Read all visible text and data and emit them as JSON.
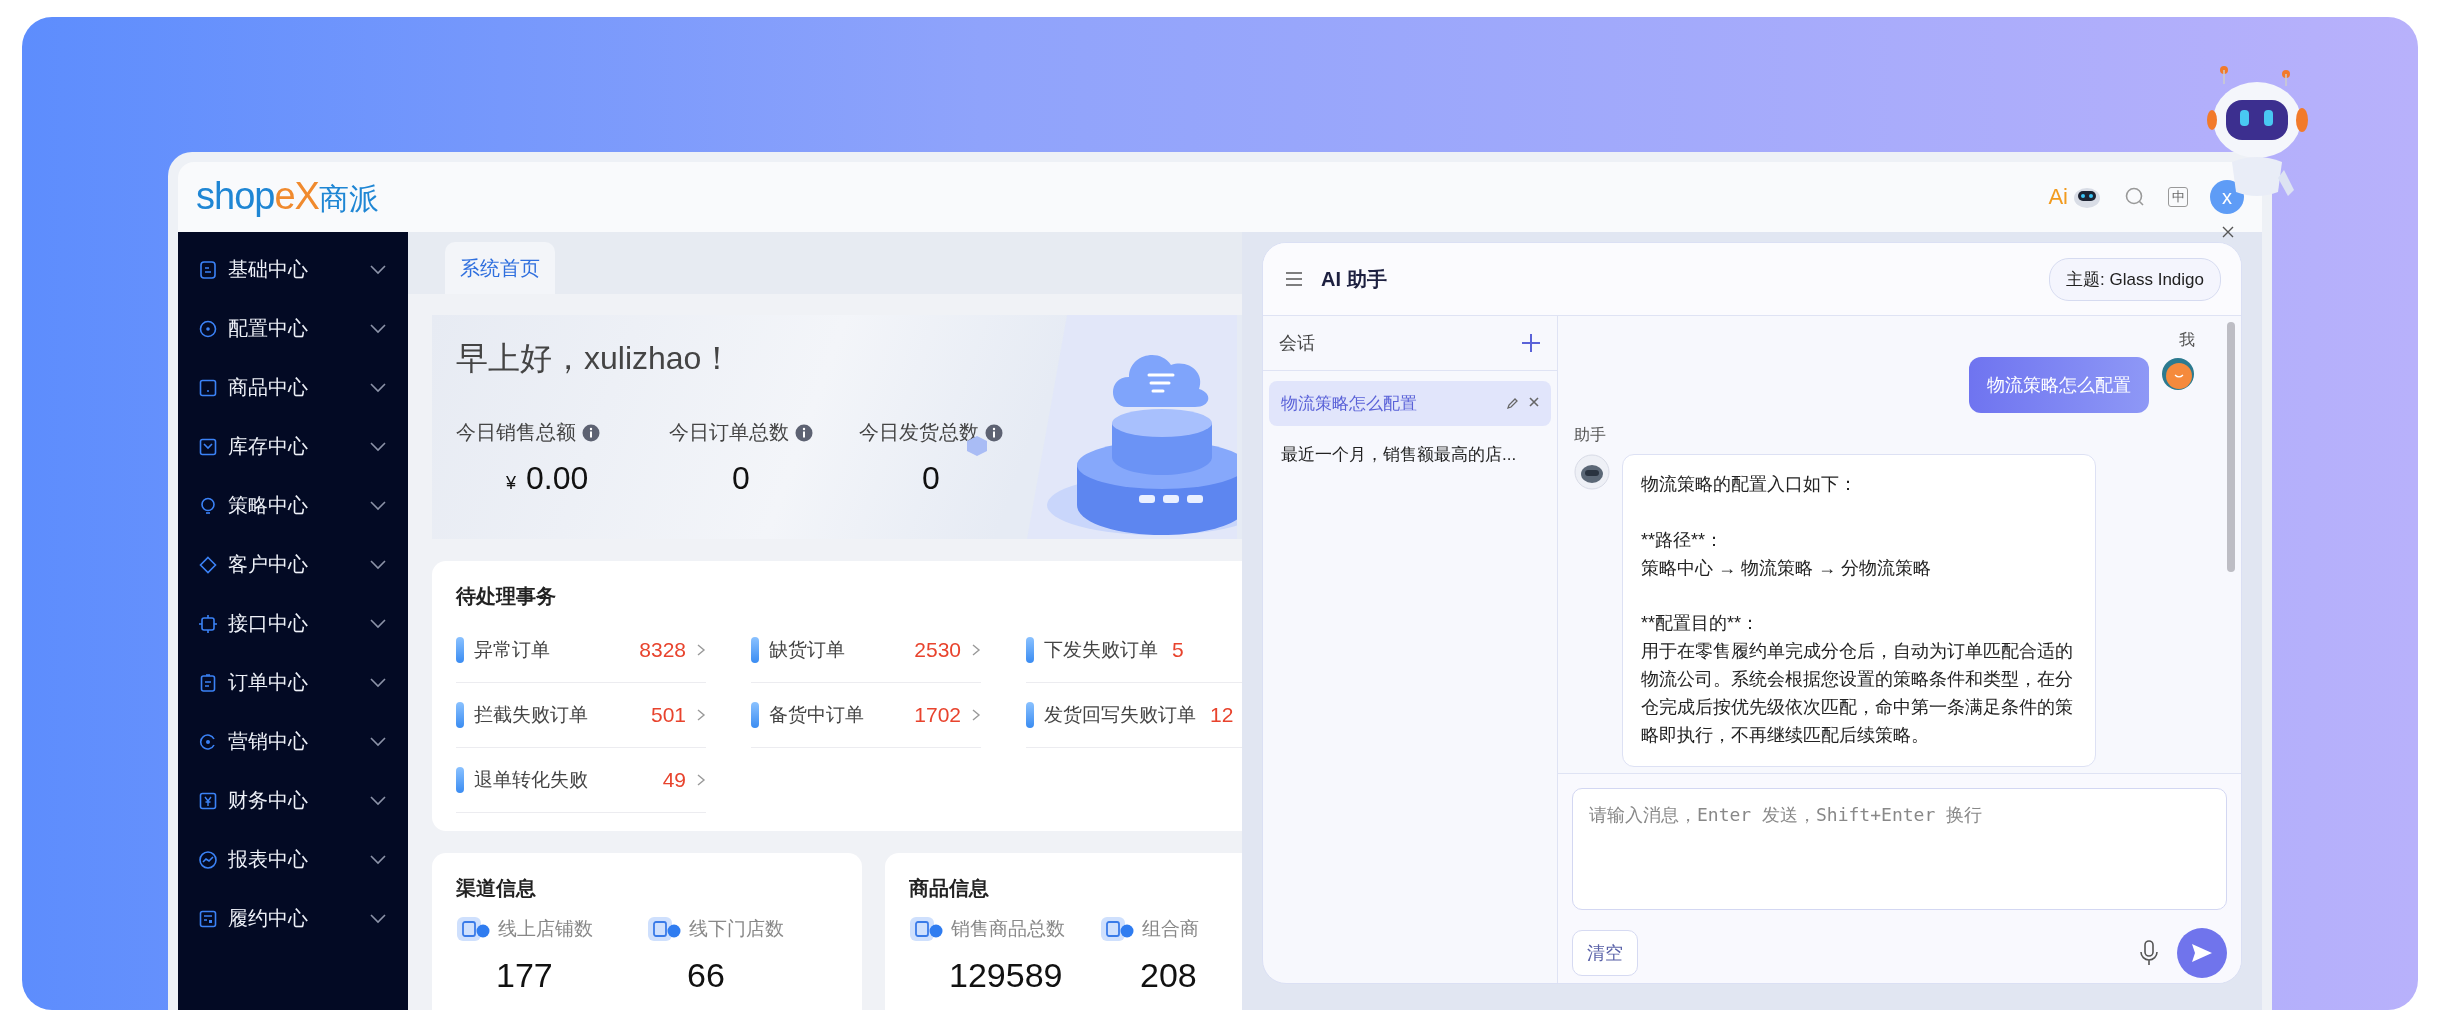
{
  "header": {
    "logo": [
      {
        "text": "shop",
        "color": "#1f86d4"
      },
      {
        "text": "eX",
        "color": "#f08a2e"
      },
      {
        "text": "商派",
        "color": "#1f86d4"
      }
    ],
    "ai_label": "Ai",
    "language": "中",
    "avatar": "x"
  },
  "sidebar": {
    "items": [
      {
        "label": "基础中心"
      },
      {
        "label": "配置中心"
      },
      {
        "label": "商品中心"
      },
      {
        "label": "库存中心"
      },
      {
        "label": "策略中心"
      },
      {
        "label": "客户中心"
      },
      {
        "label": "接口中心"
      },
      {
        "label": "订单中心"
      },
      {
        "label": "营销中心"
      },
      {
        "label": "财务中心"
      },
      {
        "label": "报表中心"
      },
      {
        "label": "履约中心"
      }
    ]
  },
  "tabs": [
    {
      "label": "系统首页",
      "selected": true
    }
  ],
  "welcome": {
    "greeting": "早上好，xulizhao！",
    "stats": [
      {
        "label": "今日销售总额",
        "currency": "¥",
        "value": "0.00"
      },
      {
        "label": "今日订单总数",
        "value": "0"
      },
      {
        "label": "今日发货总数",
        "value": "0"
      }
    ]
  },
  "pending": {
    "title": "待处理事务",
    "items": [
      {
        "label": "异常订单",
        "count": "8328"
      },
      {
        "label": "缺货订单",
        "count": "2530"
      },
      {
        "label": "下发失败订单",
        "count": "5"
      },
      {
        "label": "拦截失败订单",
        "count": "501"
      },
      {
        "label": "备货中订单",
        "count": "1702"
      },
      {
        "label": "发货回写失败订单",
        "count": "12"
      },
      {
        "label": "退单转化失败",
        "count": "49"
      }
    ]
  },
  "info_cards": [
    {
      "title": "渠道信息",
      "metrics": [
        {
          "label": "线上店铺数",
          "value": "177"
        },
        {
          "label": "线下门店数",
          "value": "66"
        }
      ]
    },
    {
      "title": "商品信息",
      "metrics": [
        {
          "label": "销售商品总数",
          "value": "129589"
        },
        {
          "label": "组合商",
          "value": "208"
        }
      ]
    }
  ],
  "assistant": {
    "title": "AI 助手",
    "theme_button": "主题: Glass Indigo",
    "sessions_header": "会话",
    "sessions": [
      {
        "title": "物流策略怎么配置",
        "selected": true
      },
      {
        "title": "最近一个月，销售额最高的店...",
        "selected": false
      }
    ],
    "messages": [
      {
        "kind": "user",
        "sender": "我",
        "text": "物流策略怎么配置"
      },
      {
        "kind": "assistant",
        "sender": "助手",
        "blocks": [
          [
            "物流策略的配置入口如下："
          ],
          [
            "**路径**：",
            "策略中心 → 物流策略 → 分物流策略"
          ],
          [
            "**配置目的**：",
            "用于在零售履约单完成分仓后，自动为订单匹配合适的物流公司。系统会根据您设置的策略条件和类型，在分仓完成后按优先级依次匹配，命中第一条满足条件的策略即执行，不再继续匹配后续策略。"
          ]
        ]
      }
    ],
    "input": {
      "placeholder": "请输入消息，Enter 发送，Shift+Enter 换行"
    },
    "clear_button": "清空"
  }
}
